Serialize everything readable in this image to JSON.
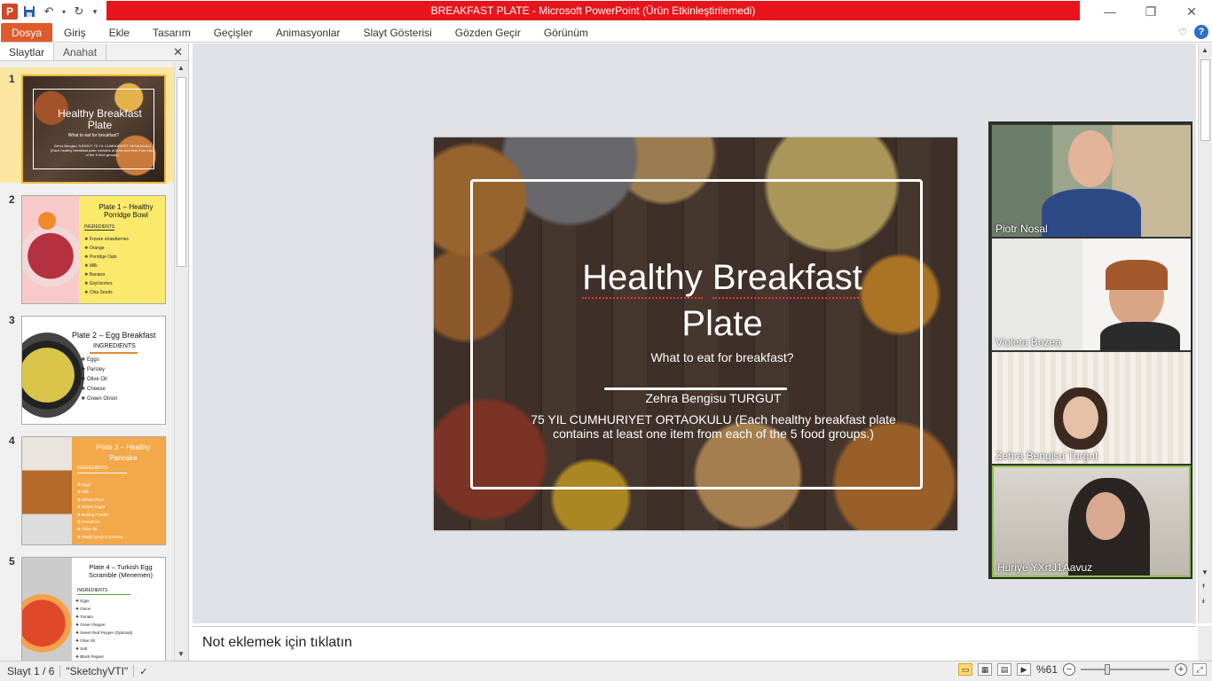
{
  "window": {
    "title": "BREAKFAST PLATE  -  Microsoft PowerPoint (Ürün Etkinleştirilemedi)",
    "app_icon_label": "P",
    "minimize": "—",
    "restore": "❐",
    "close": "✕"
  },
  "ribbon": {
    "file_tab": "Dosya",
    "tabs": [
      "Giriş",
      "Ekle",
      "Tasarım",
      "Geçişler",
      "Animasyonlar",
      "Slayt Gösterisi",
      "Gözden Geçir",
      "Görünüm"
    ],
    "help": "?"
  },
  "left_pane": {
    "tabs": [
      "Slaytlar",
      "Anahat"
    ],
    "close": "✕",
    "slides": [
      {
        "num": "1",
        "title": "Healthy Breakfast Plate",
        "subtitle": "What to eat for breakfast?",
        "text": "Zehra Bengisu TURGUT 75 YIL CUMHURIYET ORTAOKULU (Each healthy breakfast plate contains at least one item from each of the 5 food groups.)"
      },
      {
        "num": "2",
        "title": "Plate 1 – Healthy Porridge Bowl",
        "ingredients_label": "INGREDIENTS",
        "items": [
          "Frozen strawberries",
          "Orange",
          "Porridge Oats",
          "Milk",
          "Banana",
          "Goji berries",
          "Chia Seeds"
        ]
      },
      {
        "num": "3",
        "title": "Plate 2 – Egg Breakfast",
        "ingredients_label": "INGREDIENTS",
        "items": [
          "Eggs",
          "Parsley",
          "Olive Oil",
          "Cheese",
          "Green Onion"
        ]
      },
      {
        "num": "4",
        "title": "Plate 3 – Healthy Pancake",
        "ingredients_label": "INGREDIENTS",
        "items": [
          "Eggs",
          "Milk",
          "Wheat Flour",
          "Brown Sugar",
          "Baking Powder",
          "Cinnamon",
          "Olive Oil",
          "Maple syrup & Banana"
        ]
      },
      {
        "num": "5",
        "title": "Plate 4 – Turkish Egg Scramble (Menemen)",
        "ingredients_label": "INGREDIENTS",
        "items": [
          "Eggs",
          "Onion",
          "Tomato",
          "Green Pepper",
          "Sweet Red Pepper (Optional)",
          "Olive Oil",
          "Salt",
          "Black Pepper"
        ]
      }
    ]
  },
  "slide": {
    "title_word1": "Healthy",
    "title_word2": "Breakfast",
    "title_line2": "Plate",
    "subtitle": "What to eat for breakfast?",
    "author": "Zehra  Bengisu TURGUT",
    "school": "75 YIL  CUMHURIYET  ORTAOKULU (Each healthy breakfast plate contains at least one item from each of the 5 food groups.)"
  },
  "participants": [
    {
      "name": "Piotr Nosal",
      "active": false
    },
    {
      "name": "Violeta Bozea",
      "active": false
    },
    {
      "name": "Zehra Bengisu Turgut",
      "active": false
    },
    {
      "name": "Huriye YXrtJ1Aavuz",
      "active": true
    }
  ],
  "notes": {
    "placeholder": "Not eklemek için tıklatın"
  },
  "status": {
    "slide_info": "Slayt 1 / 6",
    "theme": "\"SketchyVTI\"",
    "zoom": "%61",
    "zoom_percent": 61
  }
}
